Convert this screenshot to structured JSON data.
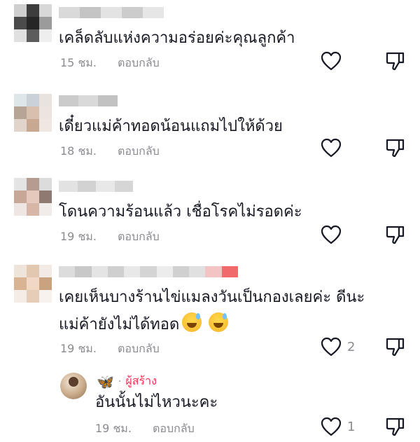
{
  "comments": [
    {
      "text": "เคล็ดลับแห่งความอร่อยค่ะคุณลูกค้า",
      "time": "15 ชม.",
      "reply_label": "ตอบกลับ",
      "like_count": ""
    },
    {
      "text": "เดี๋ยวแม่ค้าทอดน้อนแถมไปให้ด้วย",
      "time": "18 ชม.",
      "reply_label": "ตอบกลับ",
      "like_count": ""
    },
    {
      "text": "โดนความร้อนแล้ว เชื่อโรคไม่รอดค่ะ",
      "time": "19 ชม.",
      "reply_label": "ตอบกลับ",
      "like_count": ""
    },
    {
      "text_line1": "เคยเห็นบางร้านไข่แมลงวันเป็นกองเลยค่ะ ดีนะ",
      "text_line2": "แม่ค้ายังไม่ได้ทอด",
      "emojis": [
        "sweat-smile-emoji",
        "sweat-smile-emoji"
      ],
      "time": "19 ชม.",
      "reply_label": "ตอบกลับ",
      "like_count": "2"
    }
  ],
  "reply": {
    "creator_badge": "ผู้สร้าง",
    "creator_icon": "butterfly-icon",
    "separator": "·",
    "text": "อันนั้นไม่ไหวนะคะ",
    "time": "19 ชม.",
    "reply_label": "ตอบกลับ",
    "like_count": "1"
  },
  "colors": {
    "text": "#161823",
    "meta": "#8a8b91",
    "creator": "#fe2c55",
    "butterfly": "#1e88e5"
  }
}
